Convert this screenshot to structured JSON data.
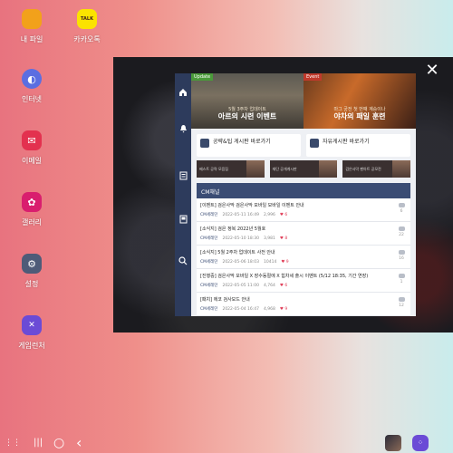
{
  "desktop": {
    "icons": [
      {
        "label": "내 파일",
        "glyph": "",
        "color": "#f2a11b",
        "icon": "folder-icon"
      },
      {
        "label": "카카오톡",
        "glyph": "TALK",
        "color": "#fbe300",
        "icon": "kakaotalk-icon"
      },
      {
        "label": "인터넷",
        "glyph": "◐",
        "color": "#5b6ee1",
        "icon": "internet-icon"
      },
      {
        "label": "이메일",
        "glyph": "✉",
        "color": "#e3314f",
        "icon": "email-icon"
      },
      {
        "label": "갤러리",
        "glyph": "✿",
        "color": "#d91e6e",
        "icon": "gallery-icon"
      },
      {
        "label": "설정",
        "glyph": "⚙",
        "color": "#4e5b78",
        "icon": "settings-icon"
      },
      {
        "label": "게임런처",
        "glyph": "✕",
        "color": "#6b4bd6",
        "icon": "game-launcher-icon"
      }
    ]
  },
  "game_window": {
    "close_glyph": "✕",
    "banners": [
      {
        "tag": "Update",
        "tag_color": "#4a9a3a",
        "sub": "5월 3주차 업데이트",
        "title": "아르의 시련 이벤트"
      },
      {
        "tag": "Event",
        "tag_color": "#c0392b",
        "sub": "마그 궁전 첫 번째 계승이나",
        "title": "야차의 패일 훈련"
      }
    ],
    "cards": [
      {
        "text": "공략&팁 게시판 바로가기"
      },
      {
        "text": "자유게시판 바로가기"
      }
    ],
    "thumbs": [
      {
        "text": "베스트 공략 모음집"
      },
      {
        "text": "재단 공개게시판"
      },
      {
        "text": "검은사막 팬아트 공모전"
      }
    ],
    "section_title": "CM채널",
    "posts": [
      {
        "title": "[이벤트] 검은사막 검은사막 모바일 모바일 이벤트 안내",
        "author": "CM세레던",
        "date": "2022-05-11 16:49",
        "views": "2,996",
        "hearts": "6",
        "comments": "6"
      },
      {
        "title": "[소식지] 검은 정복 2022년 5월호",
        "author": "CM세레던",
        "date": "2022-05-10 18:30",
        "views": "3,981",
        "hearts": "8",
        "comments": "22"
      },
      {
        "title": "[소식지] 5월 2주차 업데이트 사전 안내",
        "author": "CM세레던",
        "date": "2022-05-06 18:03",
        "views": "10414",
        "hearts": "9",
        "comments": "16"
      },
      {
        "title": "[진행중] 검은사막 모바일 X 장수동절에 X 힘차세 출시 이벤트 (5/12 18:35, 기간 연장)",
        "author": "CM세레던",
        "date": "2022-05-05 11:00",
        "views": "4,764",
        "hearts": "6",
        "comments": "1"
      },
      {
        "title": "[패치] 에코 검사모드 안내",
        "author": "CM세레던",
        "date": "2022-05-04 16:47",
        "views": "4,968",
        "hearts": "9",
        "comments": "12"
      }
    ]
  },
  "taskbar": {
    "apps_glyph": "⋮⋮",
    "recents_glyph": "|||",
    "home_glyph": "○",
    "back_glyph": "‹"
  }
}
